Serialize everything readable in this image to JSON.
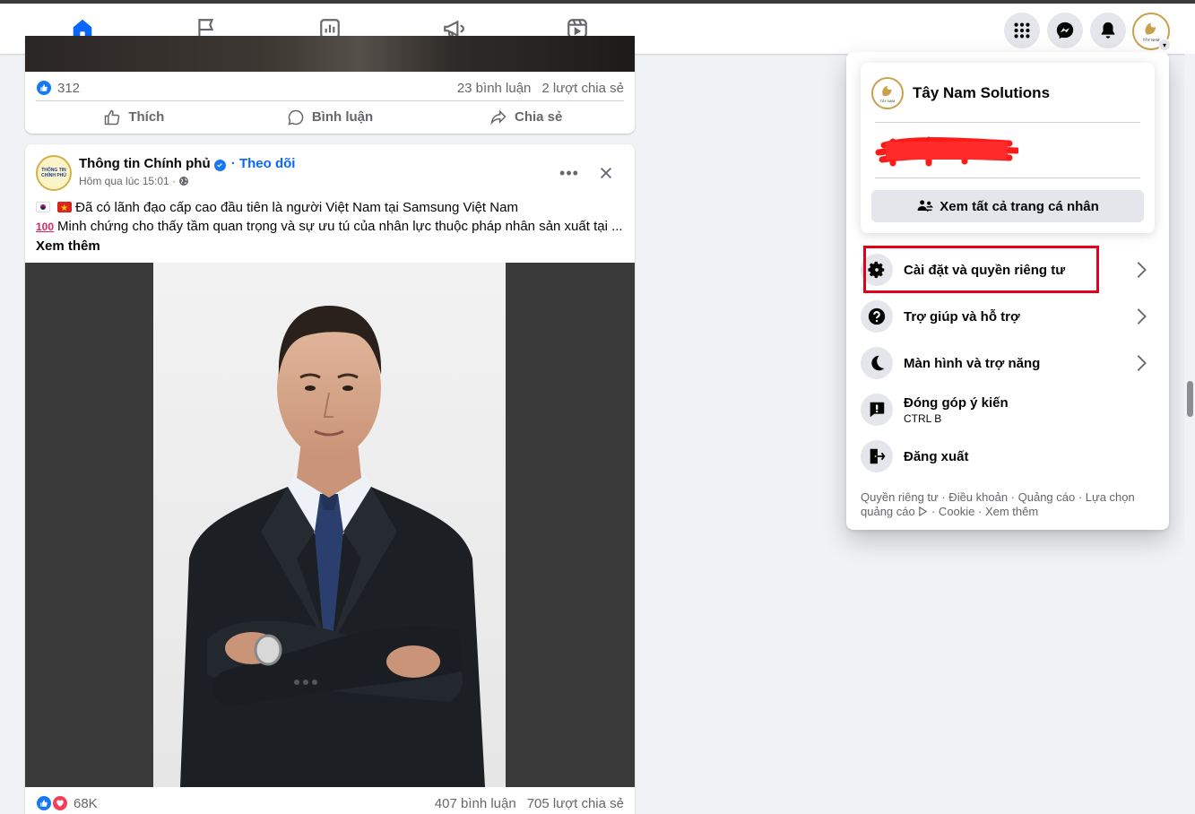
{
  "nav": {
    "tabs": [
      {
        "name": "home",
        "icon": "home-icon",
        "active": true
      },
      {
        "name": "pages",
        "icon": "flag-icon",
        "active": false
      },
      {
        "name": "insights",
        "icon": "chart-icon",
        "active": false
      },
      {
        "name": "ads",
        "icon": "megaphone-icon",
        "active": false
      },
      {
        "name": "video",
        "icon": "video-icon",
        "active": false
      }
    ],
    "accent_color": "#0866ff"
  },
  "post_top": {
    "like_count": "312",
    "comments": "23 bình luận",
    "shares": "2 lượt chia sẻ",
    "actions": {
      "like": "Thích",
      "comment": "Bình luận",
      "share": "Chia sẻ"
    }
  },
  "post": {
    "page_name": "Thông tin Chính phủ",
    "follow_label": "· Theo dõi",
    "time": "Hôm qua lúc 15:01 ·",
    "logo_text": "THÔNG TIN CHÍNH PHỦ",
    "line1": "Đã có lãnh đạo cấp cao đầu tiên là người Việt Nam tại Samsung Việt Nam",
    "line2": "Minh chứng cho thấy tầm quan trọng và sự ưu tú của nhân lực thuộc pháp nhân sản xuất tại ...",
    "hundred": "100",
    "see_more": "Xem thêm",
    "reaction_count": "68K",
    "comments": "407 bình luận",
    "shares": "705 lượt chia sẻ"
  },
  "menu": {
    "profile_name": "Tây Nam Solutions",
    "see_all_label": "Xem tất cả trang cá nhân",
    "items": [
      {
        "label": "Cài đặt và quyền riêng tư",
        "icon": "gear-icon",
        "has_chevron": true
      },
      {
        "label": "Trợ giúp và hỗ trợ",
        "icon": "help-icon",
        "has_chevron": true
      },
      {
        "label": "Màn hình và trợ năng",
        "icon": "moon-icon",
        "has_chevron": true
      },
      {
        "label": "Đóng góp ý kiến",
        "sub": "CTRL B",
        "icon": "feedback-icon",
        "has_chevron": false
      },
      {
        "label": "Đăng xuất",
        "icon": "logout-icon",
        "has_chevron": false
      }
    ],
    "footer_links": "Quyền riêng tư · Điều khoản · Quảng cáo · Lựa chọn quảng cáo",
    "footer_links2": "· Cookie · Xem thêm"
  },
  "avatar_text": "TÂY NAM",
  "highlight_color": "#e3001b"
}
